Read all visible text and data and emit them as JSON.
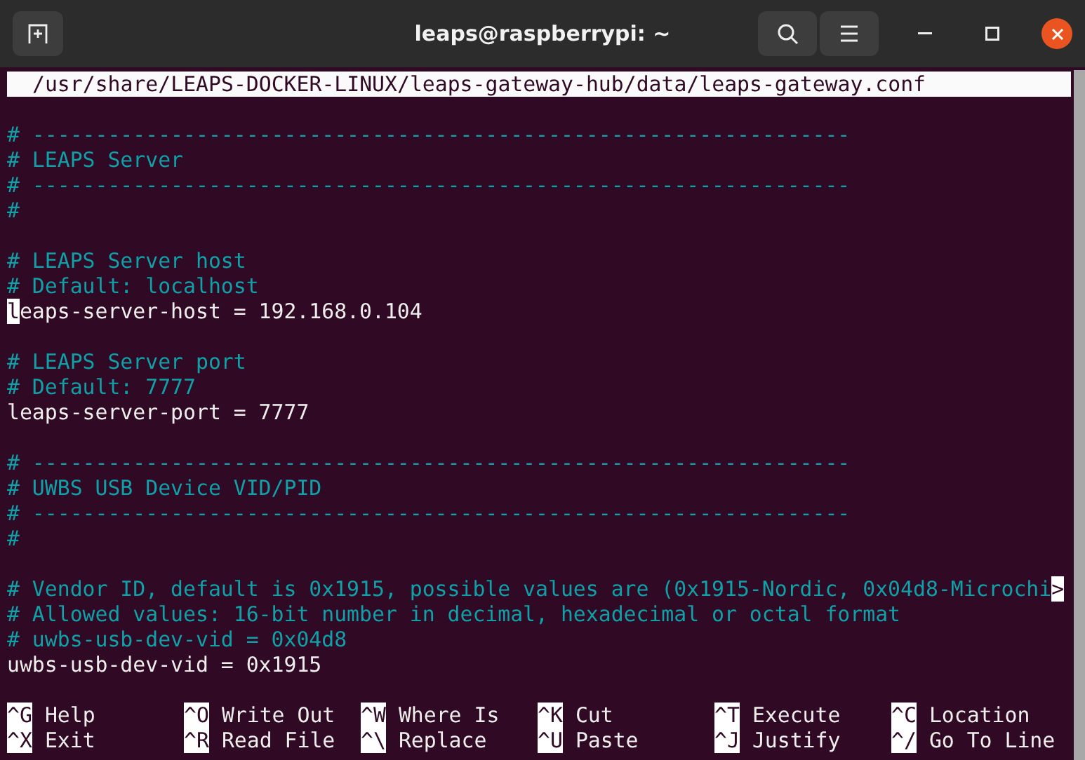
{
  "window": {
    "title": "leaps@raspberrypi: ~"
  },
  "path_bar": {
    "text": "/usr/share/LEAPS-DOCKER-LINUX/leaps-gateway-hub/data/leaps-gateway.conf"
  },
  "lines": [
    {
      "kind": "blank"
    },
    {
      "kind": "comment",
      "text": "# -----------------------------------------------------------------"
    },
    {
      "kind": "comment",
      "text": "# LEAPS Server"
    },
    {
      "kind": "comment",
      "text": "# -----------------------------------------------------------------"
    },
    {
      "kind": "comment",
      "text": "#"
    },
    {
      "kind": "blank"
    },
    {
      "kind": "comment",
      "text": "# LEAPS Server host"
    },
    {
      "kind": "comment",
      "text": "# Default: localhost"
    },
    {
      "kind": "setting",
      "text": "leaps-server-host = 192.168.0.104",
      "cursor": true
    },
    {
      "kind": "blank"
    },
    {
      "kind": "comment",
      "text": "# LEAPS Server port"
    },
    {
      "kind": "comment",
      "text": "# Default: 7777"
    },
    {
      "kind": "setting",
      "text": "leaps-server-port = 7777",
      "cursor": false
    },
    {
      "kind": "blank"
    },
    {
      "kind": "comment",
      "text": "# -----------------------------------------------------------------"
    },
    {
      "kind": "comment",
      "text": "# UWBS USB Device VID/PID"
    },
    {
      "kind": "comment",
      "text": "# -----------------------------------------------------------------"
    },
    {
      "kind": "comment",
      "text": "#"
    },
    {
      "kind": "blank"
    },
    {
      "kind": "comment",
      "text": "# Vendor ID, default is 0x1915, possible values are (0x1915-Nordic, 0x04d8-Microchi",
      "overflow_marker": ">"
    },
    {
      "kind": "comment",
      "text": "# Allowed values: 16-bit number in decimal, hexadecimal or octal format"
    },
    {
      "kind": "comment",
      "text": "# uwbs-usb-dev-vid = 0x04d8"
    },
    {
      "kind": "setting",
      "text": "uwbs-usb-dev-vid = 0x1915",
      "cursor": false
    },
    {
      "kind": "blank"
    }
  ],
  "shortcuts": [
    {
      "key": "^G",
      "label": "Help"
    },
    {
      "key": "^O",
      "label": "Write Out"
    },
    {
      "key": "^W",
      "label": "Where Is"
    },
    {
      "key": "^K",
      "label": "Cut"
    },
    {
      "key": "^T",
      "label": "Execute"
    },
    {
      "key": "^C",
      "label": "Location"
    },
    {
      "key": "^X",
      "label": "Exit"
    },
    {
      "key": "^R",
      "label": "Read File"
    },
    {
      "key": "^\\",
      "label": "Replace"
    },
    {
      "key": "^U",
      "label": "Paste"
    },
    {
      "key": "^J",
      "label": "Justify"
    },
    {
      "key": "^/",
      "label": "Go To Line"
    }
  ]
}
